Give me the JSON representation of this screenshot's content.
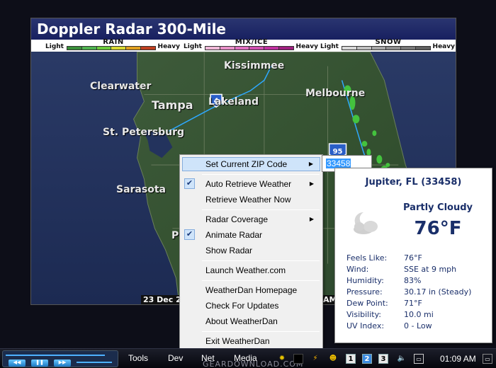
{
  "radar": {
    "title": "Doppler Radar 300-Mile",
    "legend": [
      {
        "name": "RAIN",
        "light": "Light",
        "heavy": "Heavy",
        "colors": [
          "#3a8f3a",
          "#4fb34f",
          "#6ccc3c",
          "#d9d930",
          "#e0a020",
          "#c04020"
        ]
      },
      {
        "name": "MIX/ICE",
        "light": "Light",
        "heavy": "Heavy",
        "colors": [
          "#f0b8d8",
          "#e890c8",
          "#e070c0",
          "#d050b0",
          "#c030a0",
          "#a02080"
        ]
      },
      {
        "name": "SNOW",
        "light": "Light",
        "heavy": "Heavy",
        "colors": [
          "#d8d8d8",
          "#c0c0c0",
          "#a8a8a8",
          "#909090",
          "#787878",
          "#606060"
        ]
      }
    ],
    "cities": {
      "kissimmee": "Kissimmee",
      "clearwater": "Clearwater",
      "tampa": "Tampa",
      "lakeland": "Lakeland",
      "melbourne": "Melbourne",
      "st_petersburg": "St. Petersburg",
      "sarasota": "Sarasota",
      "partial_p": "P"
    },
    "highway_4": "4",
    "highway_95": "95",
    "date_text": "23 Dec 20",
    "time_tail": "AM"
  },
  "menu": {
    "items": [
      {
        "label": "Set Current ZIP Code",
        "submenu": true,
        "highlighted": true
      },
      {
        "label": "Auto Retrieve Weather",
        "submenu": true,
        "checked": true
      },
      {
        "label": "Retrieve Weather Now"
      },
      {
        "label": "Radar Coverage",
        "submenu": true
      },
      {
        "label": "Animate Radar",
        "checked": true
      },
      {
        "label": "Show Radar"
      },
      {
        "label": "Launch Weather.com"
      },
      {
        "label": "WeatherDan Homepage"
      },
      {
        "label": "Check For Updates"
      },
      {
        "label": "About WeatherDan"
      },
      {
        "label": "Exit WeatherDan"
      }
    ],
    "arrow_glyph": "▶",
    "check_glyph": "✔"
  },
  "zip_input": {
    "value": "33458"
  },
  "weather": {
    "location": "Jupiter, FL (33458)",
    "condition": "Partly Cloudy",
    "icon": "partly-cloudy-icon",
    "temperature": "76°F",
    "details": [
      {
        "label": "Feels Like:",
        "value": "76°F"
      },
      {
        "label": "Wind:",
        "value": "SSE at 9 mph"
      },
      {
        "label": "Humidity:",
        "value": "83%"
      },
      {
        "label": "Pressure:",
        "value": "30.17 in (Steady)"
      },
      {
        "label": "Dew Point:",
        "value": "71°F"
      },
      {
        "label": "Visibility:",
        "value": "10.0 mi"
      },
      {
        "label": "UV Index:",
        "value": "0 - Low"
      }
    ]
  },
  "taskbar": {
    "toolbars": [
      "Tools",
      "Dev",
      "Net",
      "Media"
    ],
    "desktops": [
      "1",
      "2",
      "3"
    ],
    "clock": "01:09 AM",
    "watermark": "GEARDOWNLOAD.COM",
    "media_buttons": {
      "rewind": "◀◀",
      "pause": "❚❚",
      "forward": "▶▶"
    }
  }
}
